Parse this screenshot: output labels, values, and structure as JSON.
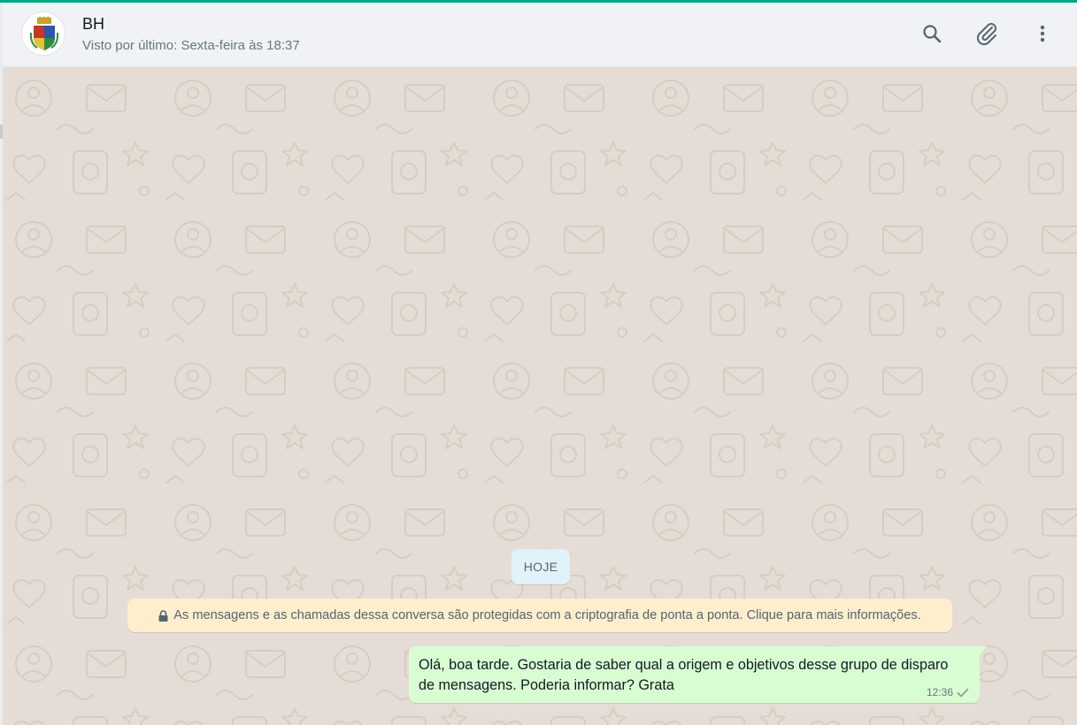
{
  "header": {
    "contact_name": "BH",
    "last_seen": "Visto por último: Sexta-feira às 18:37",
    "avatar_icon": "coat-of-arms-icon",
    "actions": [
      "search-icon",
      "attach-icon",
      "menu-icon"
    ]
  },
  "chat": {
    "date_chip": "HOJE",
    "encryption_notice": "As mensagens e as chamadas dessa conversa são protegidas com a criptografia de ponta a ponta. Clique para mais informações.",
    "messages": [
      {
        "direction": "outgoing",
        "text": "Olá, boa tarde. Gostaria de saber qual a origem e objetivos desse grupo de disparo de mensagens. Poderia informar? Grata",
        "time": "12:36",
        "status": "sent-single-check"
      }
    ]
  },
  "colors": {
    "accent": "#00a884",
    "header_bg": "#f0f2f5",
    "chat_bg": "#e5ddd5",
    "outgoing_bubble": "#d9fdd3",
    "notice_bg": "#ffeecd",
    "date_chip_bg": "#e1f2fb"
  }
}
